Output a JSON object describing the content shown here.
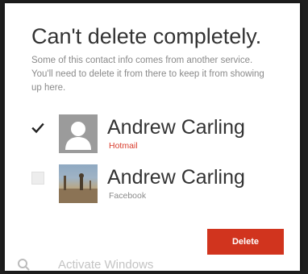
{
  "dialog": {
    "title": "Can't delete completely.",
    "description": "Some of this contact info comes from another service. You'll need to delete it from there to keep it from showing up here."
  },
  "contacts": [
    {
      "name": "Andrew Carling",
      "source": "Hotmail",
      "checked": true,
      "avatar": "generic-person-icon"
    },
    {
      "name": "Andrew Carling",
      "source": "Facebook",
      "checked": false,
      "avatar": "photo"
    }
  ],
  "actions": {
    "delete_label": "Delete"
  },
  "watermark": {
    "text": "Activate Windows"
  },
  "colors": {
    "accent": "#d1341e",
    "hotmail_source": "#d83b2b",
    "text_primary": "#333333",
    "text_secondary": "#8a8a8a"
  }
}
